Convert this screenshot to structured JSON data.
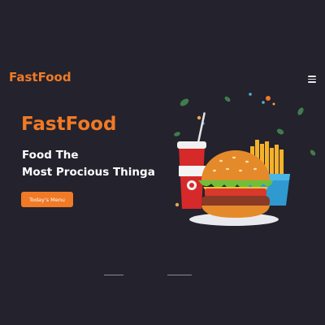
{
  "header": {
    "logo": "FastFood",
    "menu_icon": "hamburger-menu-icon"
  },
  "hero": {
    "title": "FastFood",
    "subtitle_line1": "Food The",
    "subtitle_line2": "Most Procious Thinga",
    "cta_label": "Today's Menu",
    "illustration": "burger-fries-soda-illustration"
  },
  "colors": {
    "background": "#23222d",
    "accent": "#f07a25",
    "text": "#ffffff"
  }
}
